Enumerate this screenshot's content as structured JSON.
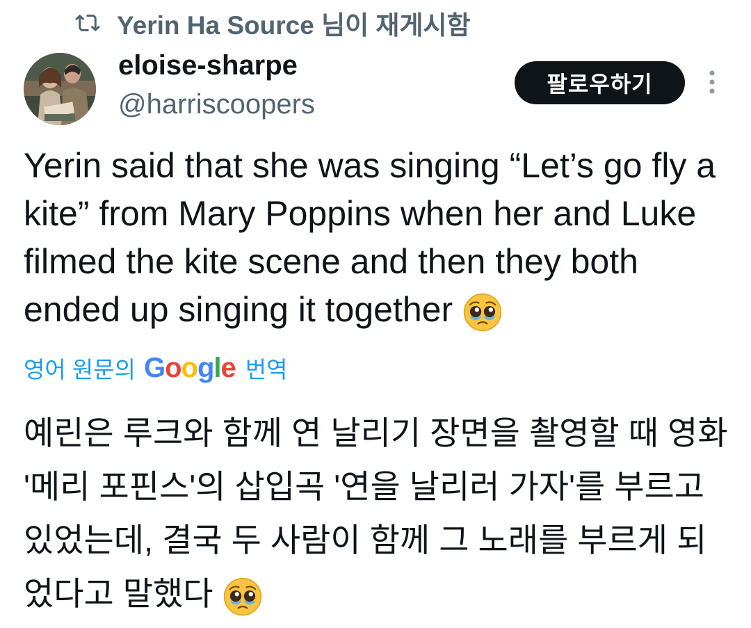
{
  "retweet": {
    "icon": "retweet-icon",
    "text": "Yerin Ha Source 님이 재게시함"
  },
  "author": {
    "avatar_icon": "avatar",
    "display_name": "eloise-sharpe",
    "handle": "@harriscoopers"
  },
  "actions": {
    "follow_label": "팔로우하기",
    "more_icon": "more-options-icon"
  },
  "tweet": {
    "text": "Yerin said that she was singing “Let’s go fly a kite” from Mary Poppins when her and Luke filmed the kite scene and then they both ended up singing it together",
    "emoji": "pleading-face-emoji"
  },
  "translation": {
    "prefix": "영어 원문의",
    "google": "Google",
    "suffix": "번역",
    "text": "예린은 루크와 함께 연 날리기 장면을 촬영할 때 영화 '메리 포핀스'의 삽입곡 '연을 날리러 가자'를 부르고 있었는데, 결국 두 사람이 함께 그 노래를 부르게 되었다고 말했다",
    "emoji": "pleading-face-emoji"
  },
  "colors": {
    "link": "#1d9bf0",
    "secondary": "#536471",
    "primary": "#0f1419",
    "button_bg": "#0f1419"
  }
}
